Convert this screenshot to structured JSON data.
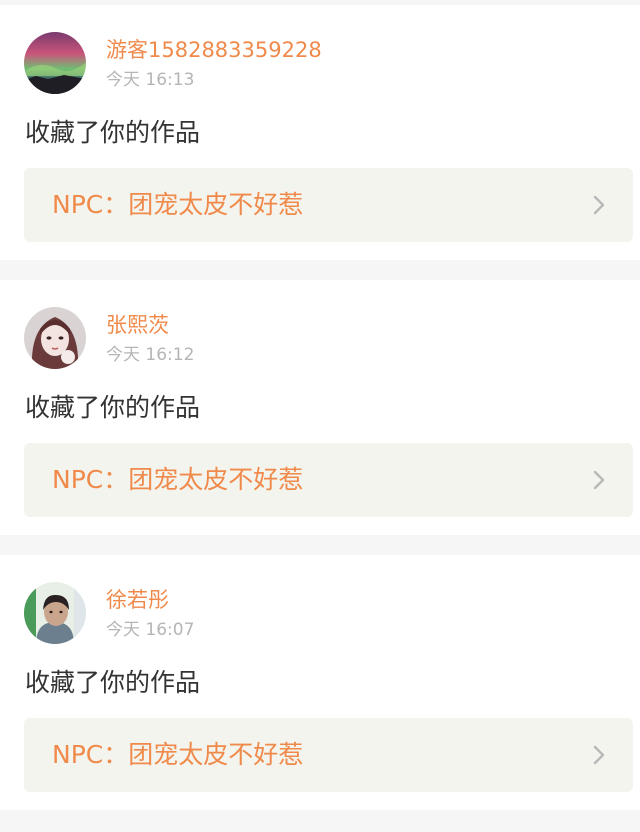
{
  "notifications": [
    {
      "username": "游客1582883359228",
      "time": "今天 16:13",
      "action": "收藏了你的作品",
      "work_title": "NPC：团宠太皮不好惹",
      "avatar": "aurora-landscape-avatar"
    },
    {
      "username": "张熙茨",
      "time": "今天 16:12",
      "action": "收藏了你的作品",
      "work_title": "NPC：团宠太皮不好惹",
      "avatar": "anime-girl-avatar"
    },
    {
      "username": "徐若彤",
      "time": "今天 16:07",
      "action": "收藏了你的作品",
      "work_title": "NPC：团宠太皮不好惹",
      "avatar": "child-photo-avatar"
    }
  ],
  "colors": {
    "accent": "#f08a4b",
    "time_text": "#b5b5b5",
    "body_text": "#333333",
    "work_card_bg": "#f4f4ee",
    "page_bg": "#f6f6f6"
  },
  "icons": {
    "chevron": "chevron-right-icon"
  }
}
